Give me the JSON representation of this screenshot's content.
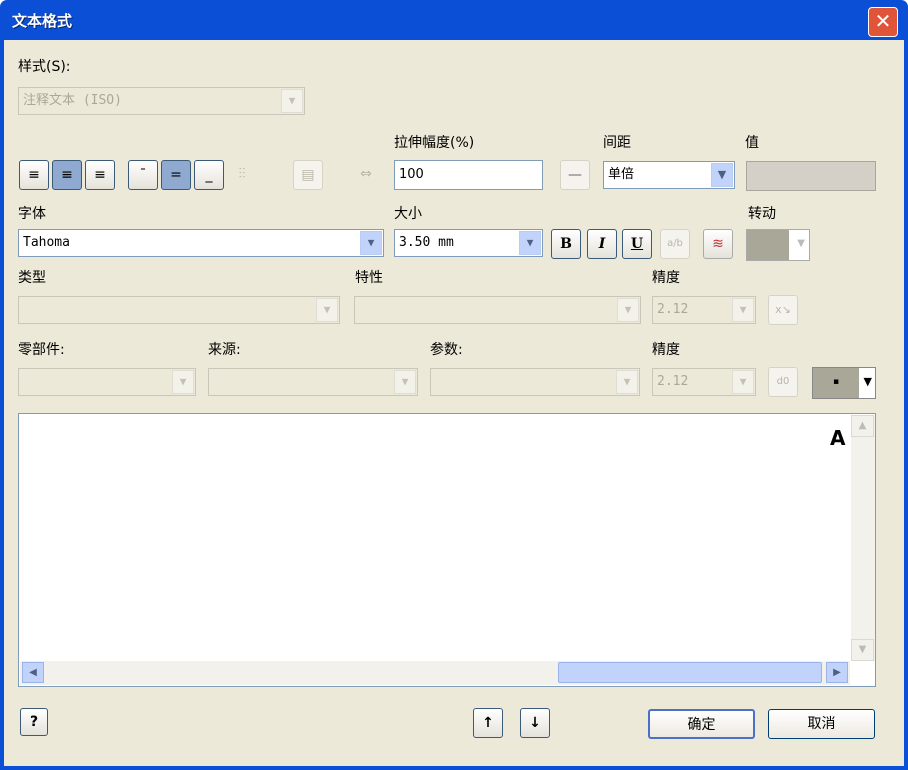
{
  "window": {
    "title": "文本格式",
    "close": "✕"
  },
  "style": {
    "label": "样式(S):",
    "value": "注释文本 (ISO)"
  },
  "labels": {
    "stretch": "拉伸幅度(%)",
    "spacing": "间距",
    "value": "值",
    "font": "字体",
    "size": "大小",
    "rotation": "转动",
    "type": "类型",
    "property": "特性",
    "precision1": "精度",
    "component": "零部件:",
    "source": "来源:",
    "parameter": "参数:",
    "precision2": "精度"
  },
  "stretch_value": "100",
  "spacing_value": "单倍",
  "font_value": "Tahoma",
  "size_value": "3.50 mm",
  "precision1_value": "2.12",
  "precision2_value": "2.12",
  "format": {
    "bold": "B",
    "italic": "I",
    "underline": "U"
  },
  "editor": {
    "preview_glyph": "A"
  },
  "buttons": {
    "help": "?",
    "ok": "确定",
    "cancel": "取消",
    "up": "↑",
    "down": "↓"
  },
  "colors": {
    "titlebar": "#0a4fd6",
    "face": "#ece9d8"
  }
}
